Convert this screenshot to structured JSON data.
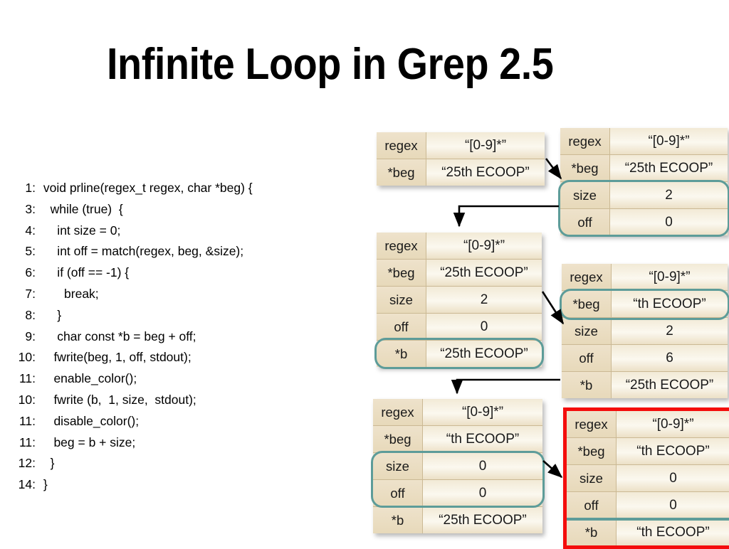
{
  "slide": {
    "title": "Infinite Loop in Grep 2.5"
  },
  "code": {
    "lines": [
      {
        "num": "1:",
        "text": " void prline(regex_t regex, char *beg) {"
      },
      {
        "num": "3:",
        "text": "   while (true)  {"
      },
      {
        "num": "4:",
        "text": "     int size = 0;"
      },
      {
        "num": "5:",
        "text": "     int off = match(regex, beg, &size);"
      },
      {
        "num": "6:",
        "text": "     if (off == -1) {"
      },
      {
        "num": "7:",
        "text": "       break;"
      },
      {
        "num": "8:",
        "text": "     }"
      },
      {
        "num": "9:",
        "text": "     char const *b = beg + off;"
      },
      {
        "num": "10:",
        "text": "    fwrite(beg, 1, off, stdout);"
      },
      {
        "num": "11:",
        "text": "    enable_color();"
      },
      {
        "num": "10:",
        "text": "    fwrite (b,  1, size,  stdout);"
      },
      {
        "num": "11:",
        "text": "    disable_color();"
      },
      {
        "num": "11:",
        "text": "    beg = b + size;"
      },
      {
        "num": "12:",
        "text": "   }"
      },
      {
        "num": "14:",
        "text": " }"
      }
    ]
  },
  "states": [
    {
      "id": "state-1",
      "rows": [
        {
          "key": "regex",
          "value": "“[0-9]*”"
        },
        {
          "key": "*beg",
          "value": "“25th ECOOP”"
        }
      ]
    },
    {
      "id": "state-2",
      "rows": [
        {
          "key": "regex",
          "value": "“[0-9]*”"
        },
        {
          "key": "*beg",
          "value": "“25th ECOOP”"
        },
        {
          "key": "size",
          "value": "2"
        },
        {
          "key": "off",
          "value": "0"
        }
      ]
    },
    {
      "id": "state-3",
      "rows": [
        {
          "key": "regex",
          "value": "“[0-9]*”"
        },
        {
          "key": "*beg",
          "value": "“25th ECOOP”"
        },
        {
          "key": "size",
          "value": "2"
        },
        {
          "key": "off",
          "value": "0"
        },
        {
          "key": "*b",
          "value": "“25th ECOOP”"
        }
      ]
    },
    {
      "id": "state-4",
      "rows": [
        {
          "key": "regex",
          "value": "“[0-9]*”"
        },
        {
          "key": "*beg",
          "value": "“th ECOOP”"
        },
        {
          "key": "size",
          "value": "2"
        },
        {
          "key": "off",
          "value": "6"
        },
        {
          "key": "*b",
          "value": "“25th ECOOP”"
        }
      ]
    },
    {
      "id": "state-5",
      "rows": [
        {
          "key": "regex",
          "value": "“[0-9]*”"
        },
        {
          "key": "*beg",
          "value": "“th ECOOP”"
        },
        {
          "key": "size",
          "value": "0"
        },
        {
          "key": "off",
          "value": "0"
        },
        {
          "key": "*b",
          "value": "“25th ECOOP”"
        }
      ]
    },
    {
      "id": "state-6",
      "rows": [
        {
          "key": "regex",
          "value": "“[0-9]*”"
        },
        {
          "key": "*beg",
          "value": "“th ECOOP”"
        },
        {
          "key": "size",
          "value": "0"
        },
        {
          "key": "off",
          "value": "0"
        },
        {
          "key": "*b",
          "value": "“th ECOOP”"
        }
      ]
    }
  ],
  "colors": {
    "highlight_teal": "#5d9c99",
    "error_red": "#f40d0c",
    "table_key_bg": "#e7d9ba",
    "table_value_bg": "#fbf8ef",
    "text": "#000000"
  }
}
